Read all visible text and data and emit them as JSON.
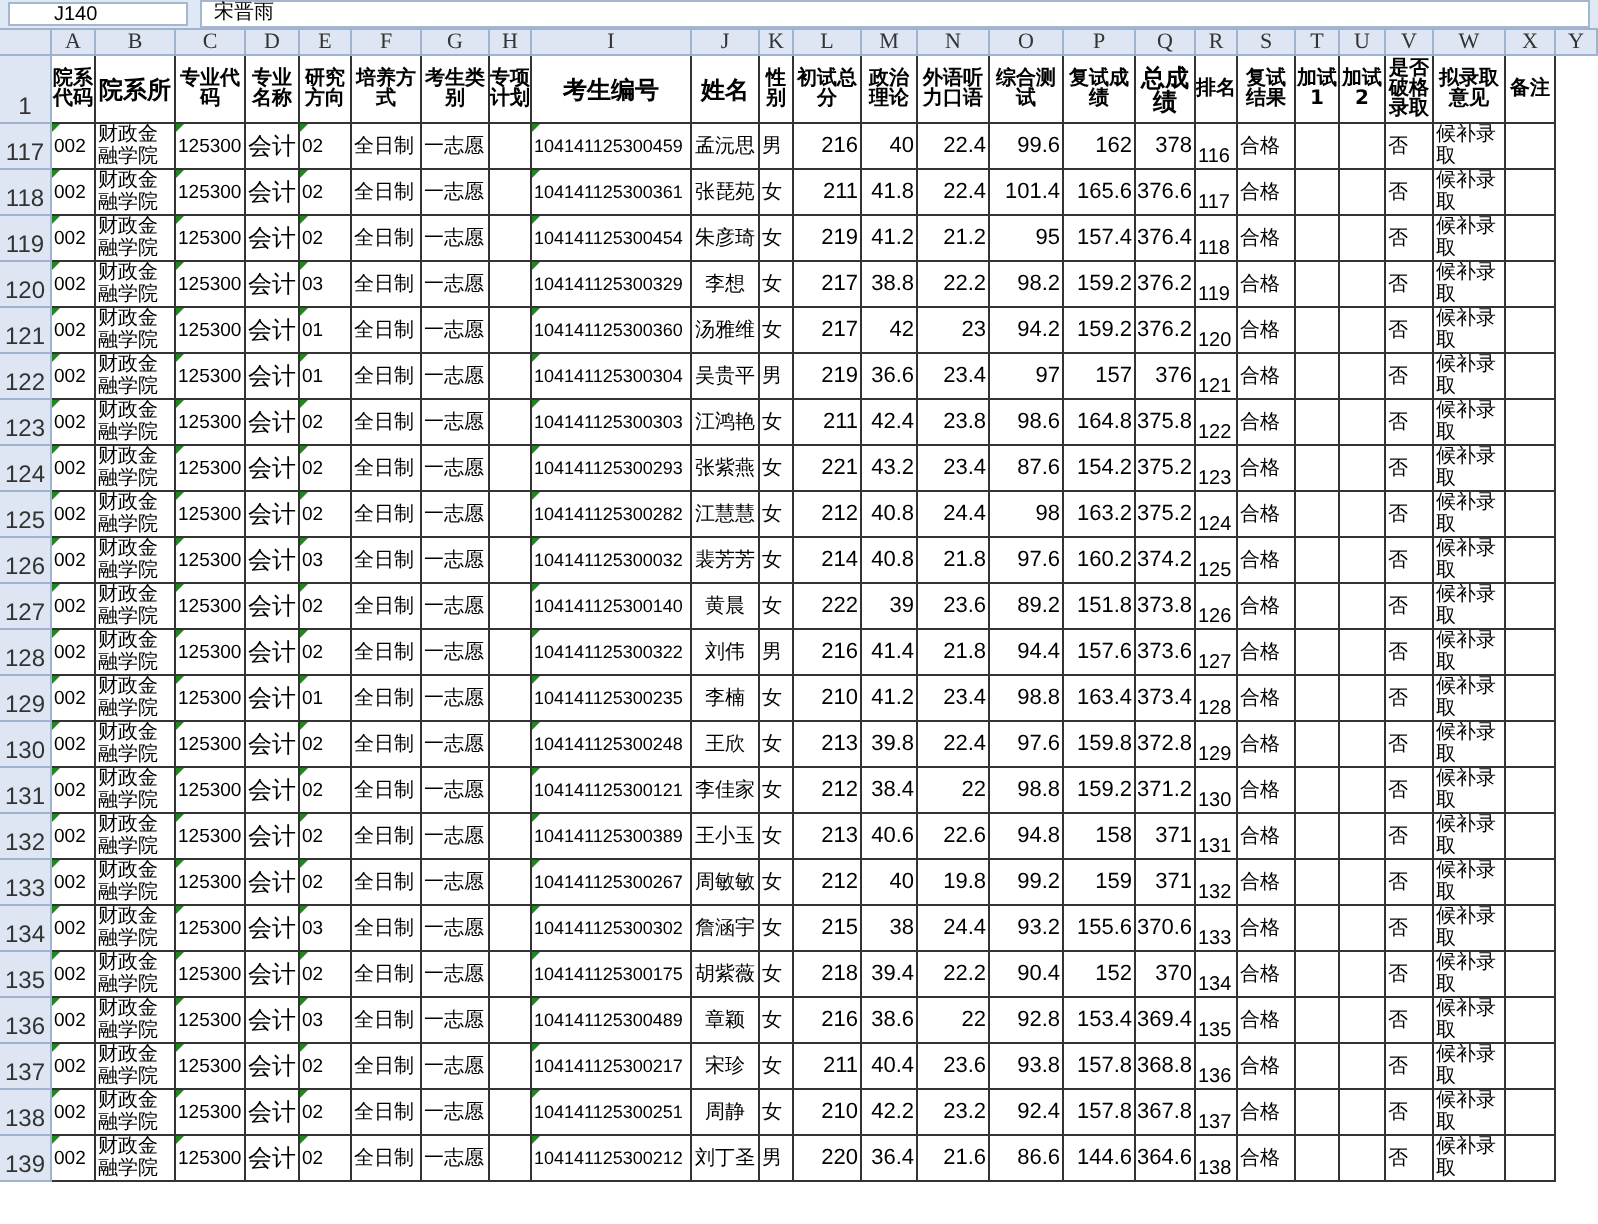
{
  "formula_bar": {
    "name_box": "J140",
    "formula": "宋晋雨"
  },
  "columns": [
    {
      "letter": "A",
      "header": "院系代码"
    },
    {
      "letter": "B",
      "header": "院系所"
    },
    {
      "letter": "C",
      "header": "专业代码"
    },
    {
      "letter": "D",
      "header": "专业名称"
    },
    {
      "letter": "E",
      "header": "研究方向"
    },
    {
      "letter": "F",
      "header": "培养方式"
    },
    {
      "letter": "G",
      "header": "考生类别"
    },
    {
      "letter": "H",
      "header": "专项计划"
    },
    {
      "letter": "I",
      "header": "考生编号"
    },
    {
      "letter": "J",
      "header": "姓名"
    },
    {
      "letter": "K",
      "header": "性别"
    },
    {
      "letter": "L",
      "header": "初试总分"
    },
    {
      "letter": "M",
      "header": "政治理论"
    },
    {
      "letter": "N",
      "header": "外语听力口语"
    },
    {
      "letter": "O",
      "header": "综合测试"
    },
    {
      "letter": "P",
      "header": "复试成绩"
    },
    {
      "letter": "Q",
      "header": "总成绩"
    },
    {
      "letter": "R",
      "header": "排名"
    },
    {
      "letter": "S",
      "header": "复试结果"
    },
    {
      "letter": "T",
      "header": "加试1"
    },
    {
      "letter": "U",
      "header": "加试2"
    },
    {
      "letter": "V",
      "header": "是否破格录取"
    },
    {
      "letter": "W",
      "header": "拟录取意见"
    },
    {
      "letter": "X",
      "header": "备注"
    },
    {
      "letter": "Y"
    }
  ],
  "header_row_number": "1",
  "rows": [
    {
      "number": "117",
      "cells": [
        "002",
        "财政金融学院",
        "125300",
        "会计",
        "02",
        "全日制",
        "一志愿",
        null,
        "104141125300459",
        "孟沅思",
        "男",
        "216",
        "40",
        "22.4",
        "99.6",
        "162",
        "378",
        "116",
        "合格",
        null,
        null,
        "否",
        "候补录取",
        null
      ]
    },
    {
      "number": "118",
      "cells": [
        "002",
        "财政金融学院",
        "125300",
        "会计",
        "02",
        "全日制",
        "一志愿",
        null,
        "104141125300361",
        "张琵苑",
        "女",
        "211",
        "41.8",
        "22.4",
        "101.4",
        "165.6",
        "376.6",
        "117",
        "合格",
        null,
        null,
        "否",
        "候补录取",
        null
      ]
    },
    {
      "number": "119",
      "cells": [
        "002",
        "财政金融学院",
        "125300",
        "会计",
        "02",
        "全日制",
        "一志愿",
        null,
        "104141125300454",
        "朱彦琦",
        "女",
        "219",
        "41.2",
        "21.2",
        "95",
        "157.4",
        "376.4",
        "118",
        "合格",
        null,
        null,
        "否",
        "候补录取",
        null
      ]
    },
    {
      "number": "120",
      "cells": [
        "002",
        "财政金融学院",
        "125300",
        "会计",
        "03",
        "全日制",
        "一志愿",
        null,
        "104141125300329",
        "李想",
        "女",
        "217",
        "38.8",
        "22.2",
        "98.2",
        "159.2",
        "376.2",
        "119",
        "合格",
        null,
        null,
        "否",
        "候补录取",
        null
      ]
    },
    {
      "number": "121",
      "cells": [
        "002",
        "财政金融学院",
        "125300",
        "会计",
        "01",
        "全日制",
        "一志愿",
        null,
        "104141125300360",
        "汤雅维",
        "女",
        "217",
        "42",
        "23",
        "94.2",
        "159.2",
        "376.2",
        "120",
        "合格",
        null,
        null,
        "否",
        "候补录取",
        null
      ]
    },
    {
      "number": "122",
      "cells": [
        "002",
        "财政金融学院",
        "125300",
        "会计",
        "01",
        "全日制",
        "一志愿",
        null,
        "104141125300304",
        "吴贵平",
        "男",
        "219",
        "36.6",
        "23.4",
        "97",
        "157",
        "376",
        "121",
        "合格",
        null,
        null,
        "否",
        "候补录取",
        null
      ]
    },
    {
      "number": "123",
      "cells": [
        "002",
        "财政金融学院",
        "125300",
        "会计",
        "02",
        "全日制",
        "一志愿",
        null,
        "104141125300303",
        "江鸿艳",
        "女",
        "211",
        "42.4",
        "23.8",
        "98.6",
        "164.8",
        "375.8",
        "122",
        "合格",
        null,
        null,
        "否",
        "候补录取",
        null
      ]
    },
    {
      "number": "124",
      "cells": [
        "002",
        "财政金融学院",
        "125300",
        "会计",
        "02",
        "全日制",
        "一志愿",
        null,
        "104141125300293",
        "张紫燕",
        "女",
        "221",
        "43.2",
        "23.4",
        "87.6",
        "154.2",
        "375.2",
        "123",
        "合格",
        null,
        null,
        "否",
        "候补录取",
        null
      ]
    },
    {
      "number": "125",
      "cells": [
        "002",
        "财政金融学院",
        "125300",
        "会计",
        "02",
        "全日制",
        "一志愿",
        null,
        "104141125300282",
        "江慧慧",
        "女",
        "212",
        "40.8",
        "24.4",
        "98",
        "163.2",
        "375.2",
        "124",
        "合格",
        null,
        null,
        "否",
        "候补录取",
        null
      ]
    },
    {
      "number": "126",
      "cells": [
        "002",
        "财政金融学院",
        "125300",
        "会计",
        "03",
        "全日制",
        "一志愿",
        null,
        "104141125300032",
        "裴芳芳",
        "女",
        "214",
        "40.8",
        "21.8",
        "97.6",
        "160.2",
        "374.2",
        "125",
        "合格",
        null,
        null,
        "否",
        "候补录取",
        null
      ]
    },
    {
      "number": "127",
      "cells": [
        "002",
        "财政金融学院",
        "125300",
        "会计",
        "02",
        "全日制",
        "一志愿",
        null,
        "104141125300140",
        "黄晨",
        "女",
        "222",
        "39",
        "23.6",
        "89.2",
        "151.8",
        "373.8",
        "126",
        "合格",
        null,
        null,
        "否",
        "候补录取",
        null
      ]
    },
    {
      "number": "128",
      "cells": [
        "002",
        "财政金融学院",
        "125300",
        "会计",
        "02",
        "全日制",
        "一志愿",
        null,
        "104141125300322",
        "刘伟",
        "男",
        "216",
        "41.4",
        "21.8",
        "94.4",
        "157.6",
        "373.6",
        "127",
        "合格",
        null,
        null,
        "否",
        "候补录取",
        null
      ]
    },
    {
      "number": "129",
      "cells": [
        "002",
        "财政金融学院",
        "125300",
        "会计",
        "01",
        "全日制",
        "一志愿",
        null,
        "104141125300235",
        "李楠",
        "女",
        "210",
        "41.2",
        "23.4",
        "98.8",
        "163.4",
        "373.4",
        "128",
        "合格",
        null,
        null,
        "否",
        "候补录取",
        null
      ]
    },
    {
      "number": "130",
      "cells": [
        "002",
        "财政金融学院",
        "125300",
        "会计",
        "02",
        "全日制",
        "一志愿",
        null,
        "104141125300248",
        "王欣",
        "女",
        "213",
        "39.8",
        "22.4",
        "97.6",
        "159.8",
        "372.8",
        "129",
        "合格",
        null,
        null,
        "否",
        "候补录取",
        null
      ]
    },
    {
      "number": "131",
      "cells": [
        "002",
        "财政金融学院",
        "125300",
        "会计",
        "02",
        "全日制",
        "一志愿",
        null,
        "104141125300121",
        "李佳家",
        "女",
        "212",
        "38.4",
        "22",
        "98.8",
        "159.2",
        "371.2",
        "130",
        "合格",
        null,
        null,
        "否",
        "候补录取",
        null
      ]
    },
    {
      "number": "132",
      "cells": [
        "002",
        "财政金融学院",
        "125300",
        "会计",
        "02",
        "全日制",
        "一志愿",
        null,
        "104141125300389",
        "王小玉",
        "女",
        "213",
        "40.6",
        "22.6",
        "94.8",
        "158",
        "371",
        "131",
        "合格",
        null,
        null,
        "否",
        "候补录取",
        null
      ]
    },
    {
      "number": "133",
      "cells": [
        "002",
        "财政金融学院",
        "125300",
        "会计",
        "02",
        "全日制",
        "一志愿",
        null,
        "104141125300267",
        "周敏敏",
        "女",
        "212",
        "40",
        "19.8",
        "99.2",
        "159",
        "371",
        "132",
        "合格",
        null,
        null,
        "否",
        "候补录取",
        null
      ]
    },
    {
      "number": "134",
      "cells": [
        "002",
        "财政金融学院",
        "125300",
        "会计",
        "03",
        "全日制",
        "一志愿",
        null,
        "104141125300302",
        "詹涵宇",
        "女",
        "215",
        "38",
        "24.4",
        "93.2",
        "155.6",
        "370.6",
        "133",
        "合格",
        null,
        null,
        "否",
        "候补录取",
        null
      ]
    },
    {
      "number": "135",
      "cells": [
        "002",
        "财政金融学院",
        "125300",
        "会计",
        "02",
        "全日制",
        "一志愿",
        null,
        "104141125300175",
        "胡紫薇",
        "女",
        "218",
        "39.4",
        "22.2",
        "90.4",
        "152",
        "370",
        "134",
        "合格",
        null,
        null,
        "否",
        "候补录取",
        null
      ]
    },
    {
      "number": "136",
      "cells": [
        "002",
        "财政金融学院",
        "125300",
        "会计",
        "03",
        "全日制",
        "一志愿",
        null,
        "104141125300489",
        "章颖",
        "女",
        "216",
        "38.6",
        "22",
        "92.8",
        "153.4",
        "369.4",
        "135",
        "合格",
        null,
        null,
        "否",
        "候补录取",
        null
      ]
    },
    {
      "number": "137",
      "cells": [
        "002",
        "财政金融学院",
        "125300",
        "会计",
        "02",
        "全日制",
        "一志愿",
        null,
        "104141125300217",
        "宋珍",
        "女",
        "211",
        "40.4",
        "23.6",
        "93.8",
        "157.8",
        "368.8",
        "136",
        "合格",
        null,
        null,
        "否",
        "候补录取",
        null
      ]
    },
    {
      "number": "138",
      "cells": [
        "002",
        "财政金融学院",
        "125300",
        "会计",
        "02",
        "全日制",
        "一志愿",
        null,
        "104141125300251",
        "周静",
        "女",
        "210",
        "42.2",
        "23.2",
        "92.4",
        "157.8",
        "367.8",
        "137",
        "合格",
        null,
        null,
        "否",
        "候补录取",
        null
      ]
    },
    {
      "number": "139",
      "cells": [
        "002",
        "财政金融学院",
        "125300",
        "会计",
        "02",
        "全日制",
        "一志愿",
        null,
        "104141125300212",
        "刘丁圣",
        "男",
        "220",
        "36.4",
        "21.6",
        "86.6",
        "144.6",
        "364.6",
        "138",
        "合格",
        null,
        null,
        "否",
        "候补录取",
        null
      ]
    }
  ]
}
